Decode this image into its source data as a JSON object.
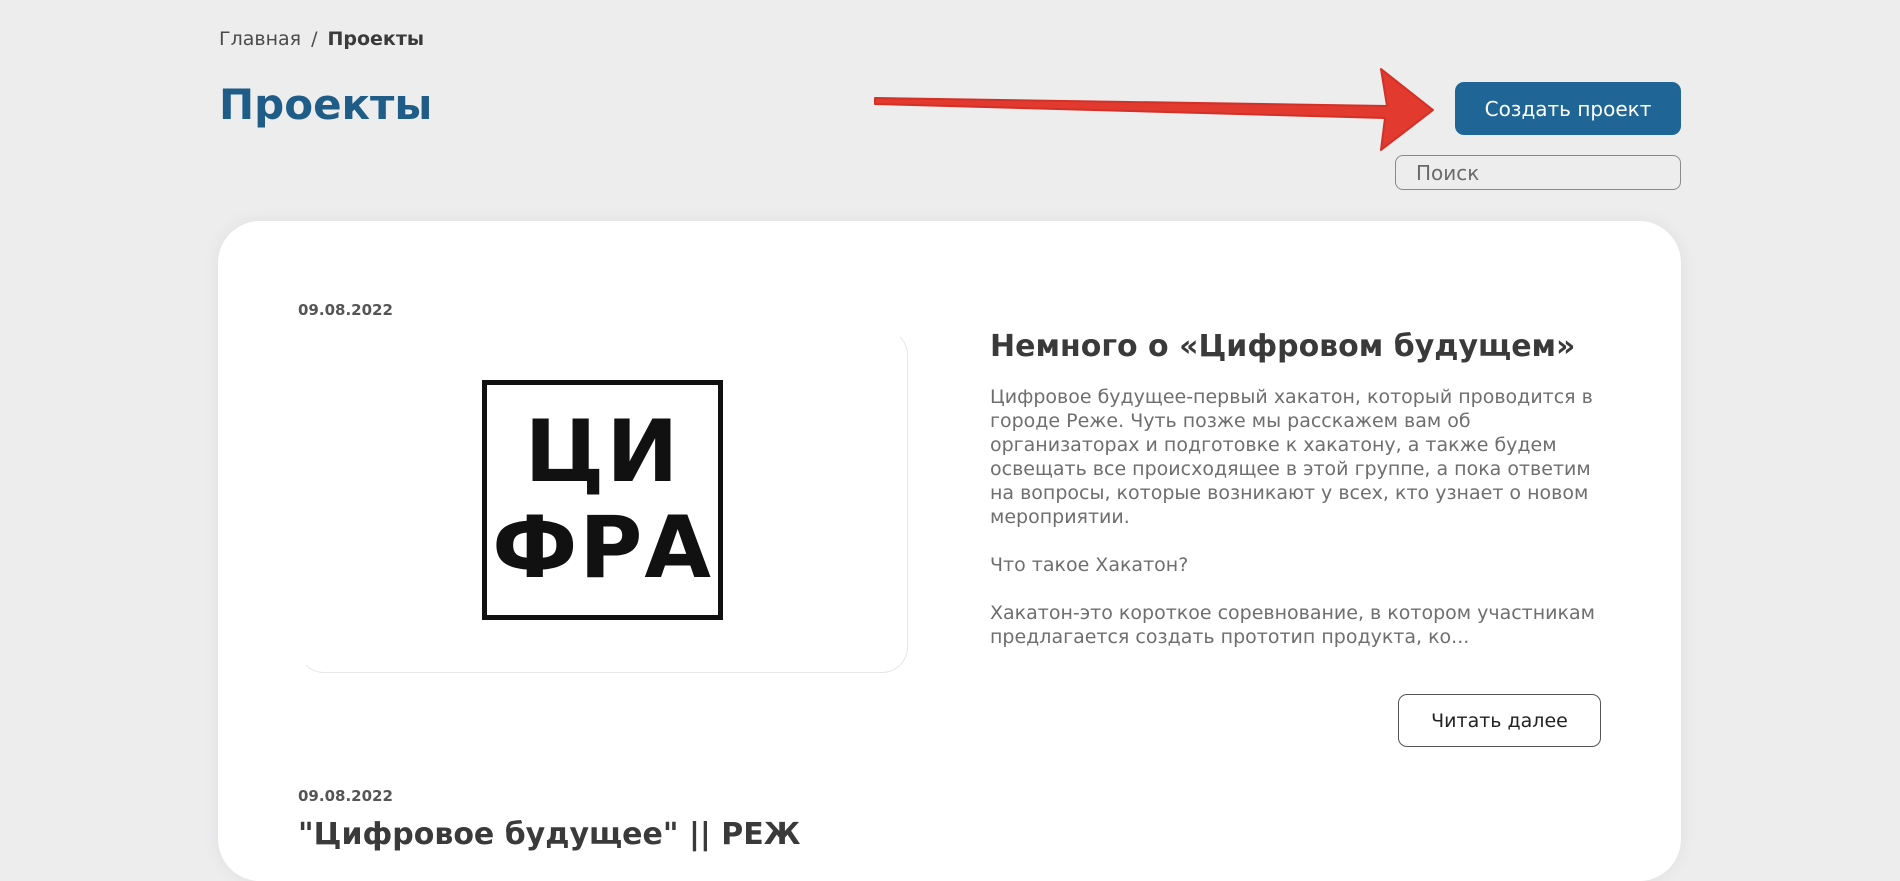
{
  "breadcrumb": {
    "home": "Главная",
    "separator": "/",
    "current": "Проекты"
  },
  "page": {
    "title": "Проекты"
  },
  "toolbar": {
    "create_label": "Создать проект",
    "search_placeholder": "Поиск"
  },
  "colors": {
    "accent": "#1f6697",
    "title": "#1f5c87",
    "arrow": "#e23a2f",
    "background": "#ededee"
  },
  "posts": [
    {
      "date": "09.08.2022",
      "title": "Немного о «Цифровом будущем»",
      "image": {
        "line1": "ЦИ",
        "line2": "ФРА"
      },
      "paragraphs": [
        "Цифровое будущее-первый хакатон, который проводится в городе Реже. Чуть позже мы расскажем вам об организаторах и подготовке к хакатону, а также будем освещать все происходящее в этой группе, а пока ответим на вопросы, которые возникают у всех, кто узнает о новом мероприятии.",
        "Что такое Хакатон?",
        "Хакатон-это короткое соревнование, в котором участникам предлагается создать прототип продукта, ко..."
      ],
      "read_more_label": "Читать далее"
    },
    {
      "date": "09.08.2022",
      "title": "\"Цифровое будущее\" || РЕЖ"
    }
  ]
}
